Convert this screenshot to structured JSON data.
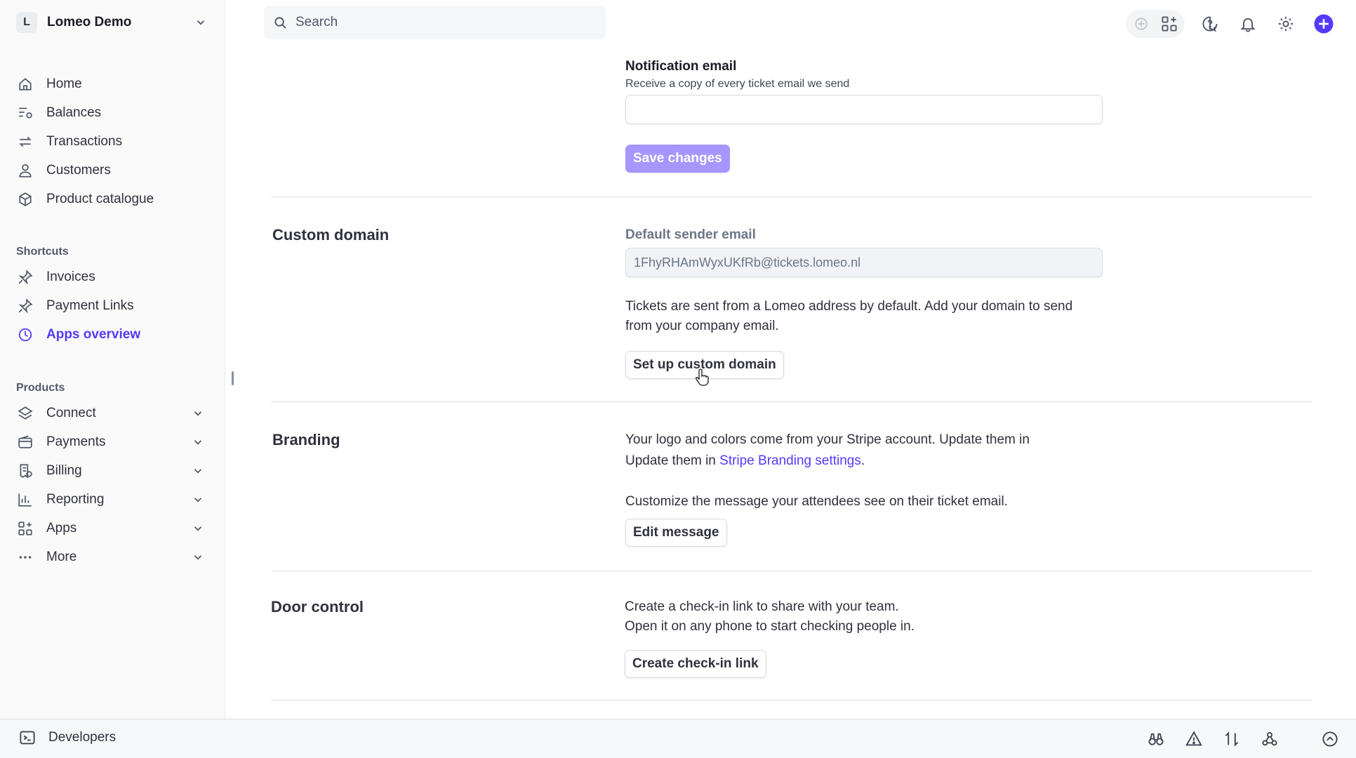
{
  "account": {
    "initial": "L",
    "name": "Lomeo Demo"
  },
  "search": {
    "label": "Search"
  },
  "nav": {
    "main": [
      {
        "label": "Home",
        "icon": "home-icon"
      },
      {
        "label": "Balances",
        "icon": "balances-icon"
      },
      {
        "label": "Transactions",
        "icon": "transactions-icon"
      },
      {
        "label": "Customers",
        "icon": "person-icon"
      },
      {
        "label": "Product catalogue",
        "icon": "box-icon"
      }
    ],
    "shortcuts_title": "Shortcuts",
    "shortcuts": [
      {
        "label": "Invoices",
        "icon": "pin-icon"
      },
      {
        "label": "Payment Links",
        "icon": "pin-icon"
      },
      {
        "label": "Apps overview",
        "icon": "clock-icon",
        "active": true
      }
    ],
    "products_title": "Products",
    "products": [
      {
        "label": "Connect",
        "icon": "layers-icon"
      },
      {
        "label": "Payments",
        "icon": "wallet-icon"
      },
      {
        "label": "Billing",
        "icon": "billing-icon"
      },
      {
        "label": "Reporting",
        "icon": "bar-chart-icon"
      },
      {
        "label": "Apps",
        "icon": "apps-grid-icon"
      },
      {
        "label": "More",
        "icon": "more-dots-icon"
      }
    ]
  },
  "notification": {
    "label": "Notification email",
    "help": "Receive a copy of every ticket email we send",
    "value": "",
    "save_label": "Save changes"
  },
  "custom_domain": {
    "title": "Custom domain",
    "sender_label": "Default sender email",
    "sender_value": "1FhyRHAmWyxUKfRb@tickets.lomeo.nl",
    "desc_line1": "Tickets are sent from a Lomeo address by default. Add your domain to send",
    "desc_line2": "from your company email.",
    "button_label": "Set up custom domain"
  },
  "branding": {
    "title": "Branding",
    "line1": "Your logo and colors come from your Stripe account. Update them in",
    "line2_prefix": "Update them in ",
    "link_label": "Stripe Branding settings",
    "line2_suffix": ".",
    "customize_text": "Customize the message your attendees see on their ticket email.",
    "button_label": "Edit message"
  },
  "door_control": {
    "title": "Door control",
    "line1": "Create a check-in link to share with your team.",
    "line2": "Open it on any phone to start checking people in.",
    "button_label": "Create check-in link"
  },
  "devbar": {
    "label": "Developers"
  },
  "colors": {
    "accent": "#533afd",
    "primary_button": "#a796ff"
  }
}
